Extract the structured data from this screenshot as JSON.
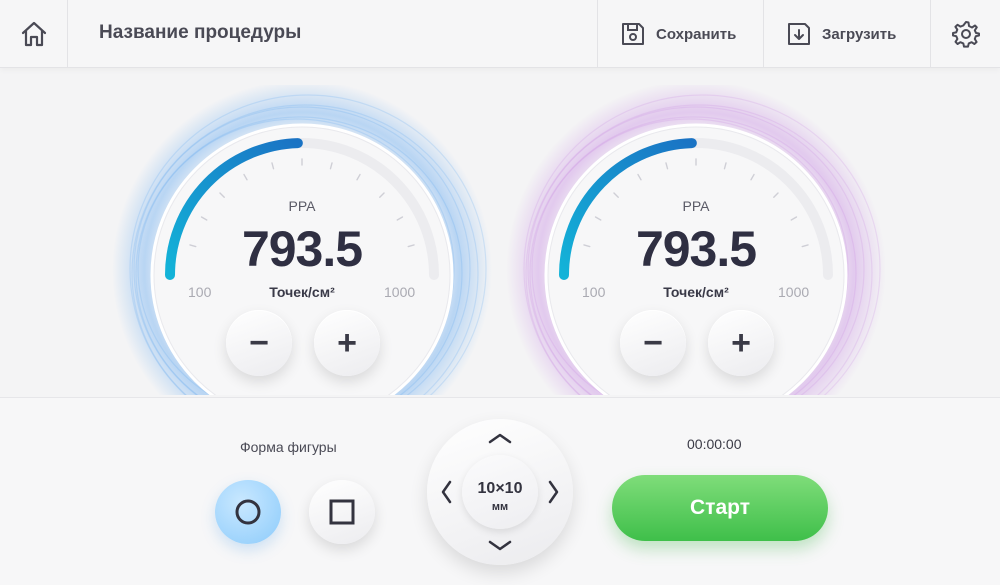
{
  "header": {
    "title": "Название процедуры",
    "save_label": "Сохранить",
    "load_label": "Загрузить",
    "icons": {
      "home": "home-icon",
      "save": "save-icon",
      "load": "download-icon",
      "settings": "gear-icon"
    }
  },
  "gauges": [
    {
      "label": "PPA",
      "value": "793.5",
      "unit": "Точек/см²",
      "min": "100",
      "max": "1000",
      "fill_fraction": 0.49,
      "aura_color": "#4a9cf0"
    },
    {
      "label": "PPA",
      "value": "793.5",
      "unit": "Точек/см²",
      "min": "100",
      "max": "1000",
      "fill_fraction": 0.49,
      "aura_color": "#c07be0"
    }
  ],
  "controls": {
    "minus": "−",
    "plus": "+",
    "shape_label": "Форма фигуры",
    "shapes": [
      "circle",
      "square"
    ],
    "selected_shape": "circle",
    "size_value": "10×10",
    "size_unit": "мм",
    "timer": "00:00:00",
    "start_label": "Старт"
  },
  "colors": {
    "accent_blue": "#1aa3dc",
    "start_green": "#4cc452",
    "selected_shape": "#9dd3fb"
  }
}
